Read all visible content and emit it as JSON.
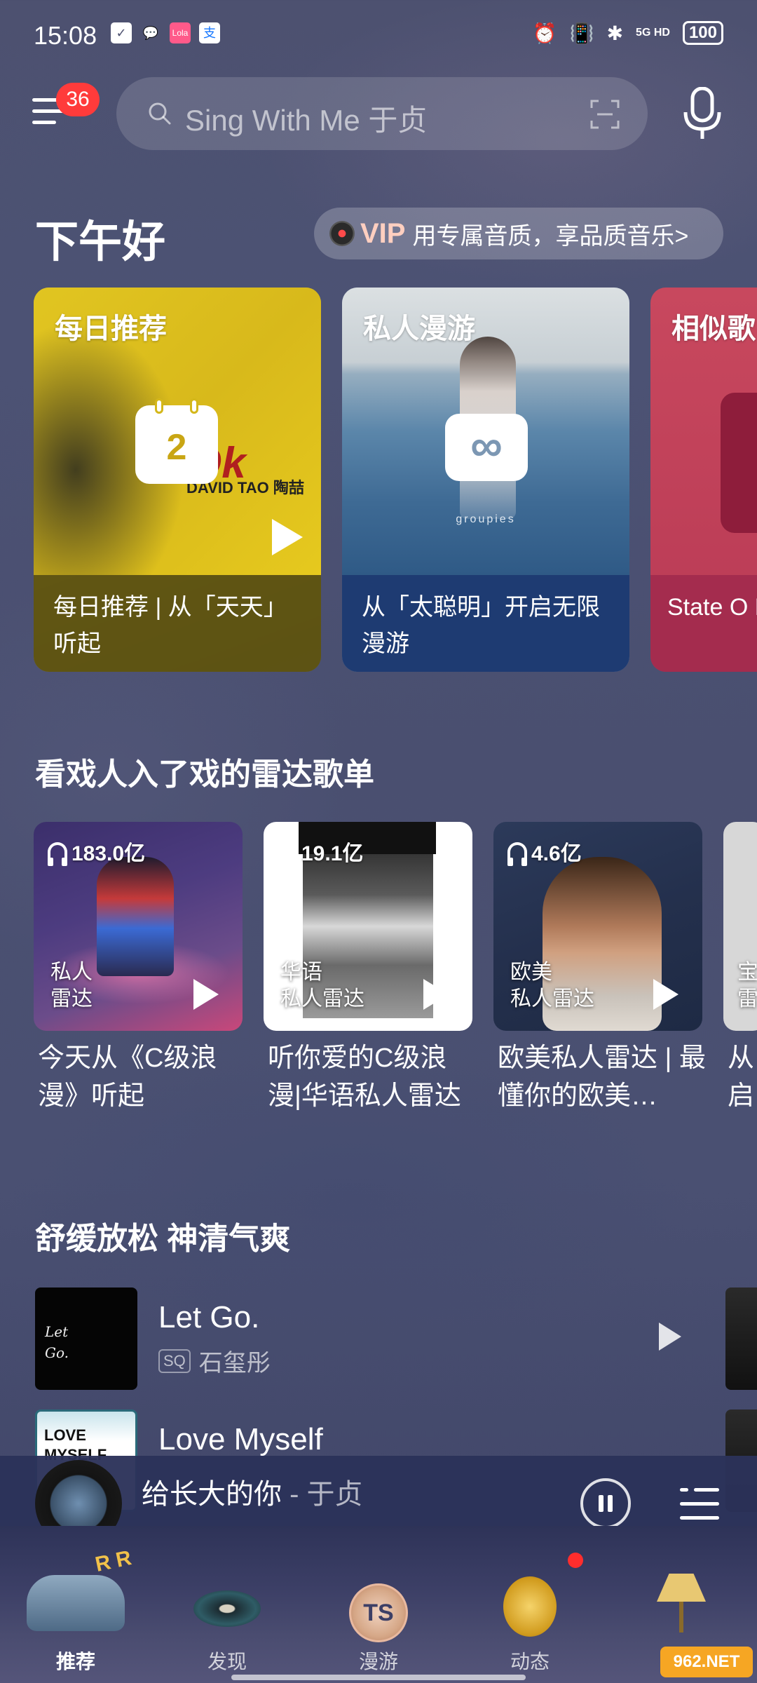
{
  "status_bar": {
    "time": "15:08",
    "network": "5G HD",
    "battery": "100"
  },
  "top_bar": {
    "badge_count": "36",
    "search_placeholder": "Sing With Me 于贞"
  },
  "greeting": "下午好",
  "vip_banner": {
    "label": "VIP",
    "text": "用专属音质，享品质音乐>"
  },
  "featured_cards": [
    {
      "title": "每日推荐",
      "calendar_day": "2",
      "cover_text": "Ok",
      "cover_artist": "DAVID TAO 陶喆",
      "subtitle": "每日推荐 | 从「天天」听起"
    },
    {
      "title": "私人漫游",
      "cover_text": "groupies",
      "subtitle": "从「太聪明」开启无限漫游"
    },
    {
      "title": "相似歌",
      "subtitle": "State O Будапе"
    }
  ],
  "radar_section": {
    "title": "看戏人入了戏的雷达歌单",
    "items": [
      {
        "count": "183.0亿",
        "label_line1": "私人",
        "label_line2": "雷达",
        "caption": "今天从《C级浪漫》听起"
      },
      {
        "count": "19.1亿",
        "label_line1": "华语",
        "label_line2": "私人雷达",
        "caption": "听你爱的C级浪漫|华语私人雷达"
      },
      {
        "count": "4.6亿",
        "label_line1": "欧美",
        "label_line2": "私人雷达",
        "caption": "欧美私人雷达 | 最懂你的欧美…"
      },
      {
        "count": "",
        "label_line1": "宝",
        "label_line2": "雷",
        "caption": "从启"
      }
    ]
  },
  "relax_section": {
    "title": "舒缓放松 神清气爽",
    "songs": [
      {
        "name": "Let Go.",
        "quality": "SQ",
        "artist": "石玺彤",
        "cover_text": "Let Go."
      },
      {
        "name": "Love Myself",
        "quality": "",
        "artist": "",
        "cover_text": "LOVE MYSELF"
      }
    ]
  },
  "mini_player": {
    "song": "给长大的你",
    "separator": " - ",
    "artist": "于贞"
  },
  "bottom_nav": [
    {
      "label": "推荐",
      "active": true
    },
    {
      "label": "发现",
      "active": false
    },
    {
      "label": "漫游",
      "active": false
    },
    {
      "label": "动态",
      "active": false
    },
    {
      "label": "",
      "active": false
    }
  ],
  "nav_decor": {
    "rr_text": "R R",
    "ts_text": "TS"
  },
  "watermark": "962.NET",
  "colors": {
    "badge": "#ff3b3b",
    "vip": "#ffcfc0",
    "daily_card": "#d9bf1c",
    "roam_card_bottom": "#1e3b72",
    "similar_card": "#c8485e",
    "mini_player": "#2c325a"
  }
}
